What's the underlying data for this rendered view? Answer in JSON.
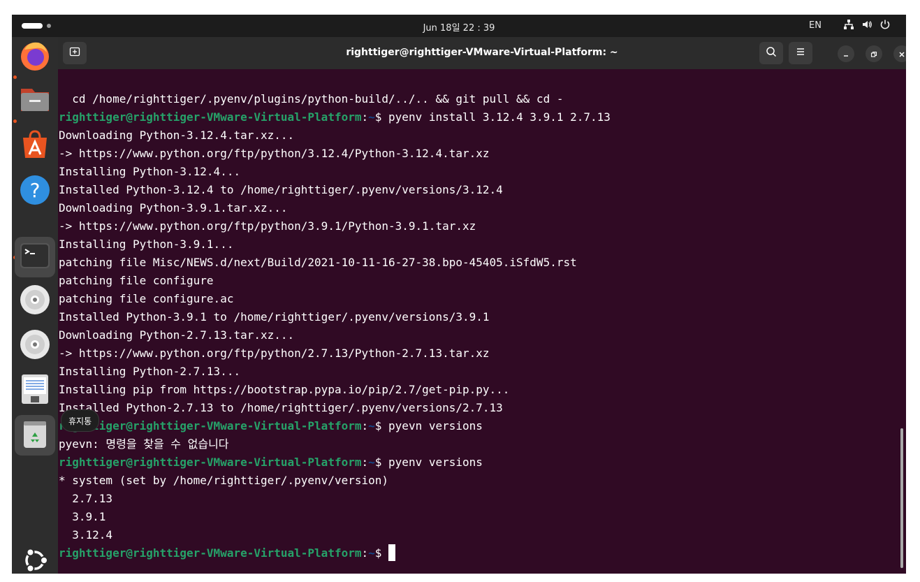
{
  "topbar": {
    "clock": "Jun 18일  22 : 39",
    "language": "EN",
    "icons": [
      "network-icon",
      "volume-icon",
      "power-icon"
    ]
  },
  "dock": {
    "items": [
      {
        "name": "firefox",
        "icon": "firefox-icon",
        "running": true
      },
      {
        "name": "files",
        "icon": "files-icon",
        "running": true
      },
      {
        "name": "app-center",
        "icon": "app-center-icon",
        "running": false
      },
      {
        "name": "help",
        "icon": "help-icon",
        "running": false
      },
      {
        "name": "terminal",
        "icon": "terminal-icon",
        "running": true,
        "active": true
      },
      {
        "name": "disc-1",
        "icon": "disc-icon",
        "running": false
      },
      {
        "name": "disc-2",
        "icon": "disc-icon",
        "running": false
      },
      {
        "name": "text-editor",
        "icon": "text-editor-icon",
        "running": false
      },
      {
        "name": "trash",
        "icon": "trash-icon",
        "running": false,
        "hovered": true
      },
      {
        "name": "show-apps",
        "icon": "ubuntu-logo-icon",
        "running": false
      }
    ],
    "tooltip": "휴지통"
  },
  "window": {
    "title": "righttiger@righttiger-VMware-Virtual-Platform: ~",
    "colors": {
      "background": "#300a24",
      "prompt_user": "#26a269",
      "prompt_path": "#12488b",
      "text": "#ffffff"
    }
  },
  "terminal": {
    "prompt_user": "righttiger@righttiger-VMware-Virtual-Platform",
    "prompt_path": "~",
    "lines": [
      {
        "type": "out",
        "text": "  cd /home/righttiger/.pyenv/plugins/python-build/../.. && git pull && cd -"
      },
      {
        "type": "cmd",
        "cmd": " pyenv install 3.12.4 3.9.1 2.7.13"
      },
      {
        "type": "out",
        "text": "Downloading Python-3.12.4.tar.xz..."
      },
      {
        "type": "out",
        "text": "-> https://www.python.org/ftp/python/3.12.4/Python-3.12.4.tar.xz"
      },
      {
        "type": "out",
        "text": "Installing Python-3.12.4..."
      },
      {
        "type": "out",
        "text": "Installed Python-3.12.4 to /home/righttiger/.pyenv/versions/3.12.4"
      },
      {
        "type": "out",
        "text": "Downloading Python-3.9.1.tar.xz..."
      },
      {
        "type": "out",
        "text": "-> https://www.python.org/ftp/python/3.9.1/Python-3.9.1.tar.xz"
      },
      {
        "type": "out",
        "text": "Installing Python-3.9.1..."
      },
      {
        "type": "out",
        "text": "patching file Misc/NEWS.d/next/Build/2021-10-11-16-27-38.bpo-45405.iSfdW5.rst"
      },
      {
        "type": "out",
        "text": "patching file configure"
      },
      {
        "type": "out",
        "text": "patching file configure.ac"
      },
      {
        "type": "out",
        "text": "Installed Python-3.9.1 to /home/righttiger/.pyenv/versions/3.9.1"
      },
      {
        "type": "out",
        "text": "Downloading Python-2.7.13.tar.xz..."
      },
      {
        "type": "out",
        "text": "-> https://www.python.org/ftp/python/2.7.13/Python-2.7.13.tar.xz"
      },
      {
        "type": "out",
        "text": "Installing Python-2.7.13..."
      },
      {
        "type": "out",
        "text": "Installing pip from https://bootstrap.pypa.io/pip/2.7/get-pip.py..."
      },
      {
        "type": "out",
        "text": "Installed Python-2.7.13 to /home/righttiger/.pyenv/versions/2.7.13"
      },
      {
        "type": "cmd",
        "cmd": " pyevn versions"
      },
      {
        "type": "out",
        "text": "pyevn: 명령을 찾을 수 없습니다"
      },
      {
        "type": "cmd",
        "cmd": " pyenv versions"
      },
      {
        "type": "out",
        "text": "* system (set by /home/righttiger/.pyenv/version)"
      },
      {
        "type": "out",
        "text": "  2.7.13"
      },
      {
        "type": "out",
        "text": "  3.9.1"
      },
      {
        "type": "out",
        "text": "  3.12.4"
      },
      {
        "type": "cmd",
        "cmd": " ",
        "cursor": true
      }
    ]
  }
}
